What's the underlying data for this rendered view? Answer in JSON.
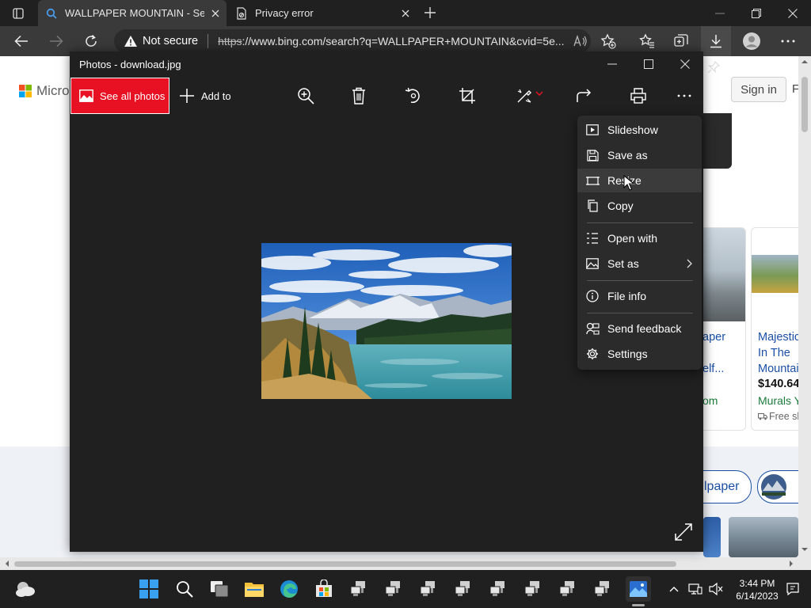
{
  "browser": {
    "tabs": [
      {
        "title": "WALLPAPER MOUNTAIN - Search",
        "active": true
      },
      {
        "title": "Privacy error",
        "active": false
      }
    ],
    "address": {
      "security_label": "Not secure",
      "url_scheme": "https",
      "url_rest": "://www.bing.com/search?q=WALLPAPER+MOUNTAIN&cvid=5e..."
    }
  },
  "page": {
    "logo_text": "Micros",
    "signin": "Sign in",
    "right_cut": "F",
    "card_a": {
      "title1": "aper",
      "title2": "elf...",
      "store": "om"
    },
    "card_b": {
      "title1": "Majestic",
      "title2": "In The",
      "title3": "Mountai",
      "price": "$140.64",
      "store": "Murals Y",
      "ship": "Free sl"
    },
    "pill_text": "lpaper"
  },
  "photos_app": {
    "title": "Photos - download.jpg",
    "see_all": "See all photos",
    "add_to": "Add to"
  },
  "context_menu": {
    "items": [
      {
        "label": "Slideshow",
        "icon": "slideshow-icon"
      },
      {
        "label": "Save as",
        "icon": "save-icon"
      },
      {
        "label": "Resize",
        "icon": "resize-icon",
        "highlighted": true
      },
      {
        "label": "Copy",
        "icon": "copy-icon"
      },
      {
        "label": "Open with",
        "icon": "open-with-icon"
      },
      {
        "label": "Set as",
        "icon": "image-icon",
        "submenu": true
      },
      {
        "label": "File info",
        "icon": "info-icon"
      },
      {
        "label": "Send feedback",
        "icon": "feedback-icon"
      },
      {
        "label": "Settings",
        "icon": "gear-icon"
      }
    ]
  },
  "taskbar": {
    "time": "3:44 PM",
    "date": "6/14/2023"
  },
  "colors": {
    "accent_red": "#e81123",
    "link_blue": "#1a4fa5",
    "store_green": "#1b7b3a",
    "dark_bg": "#202020"
  }
}
